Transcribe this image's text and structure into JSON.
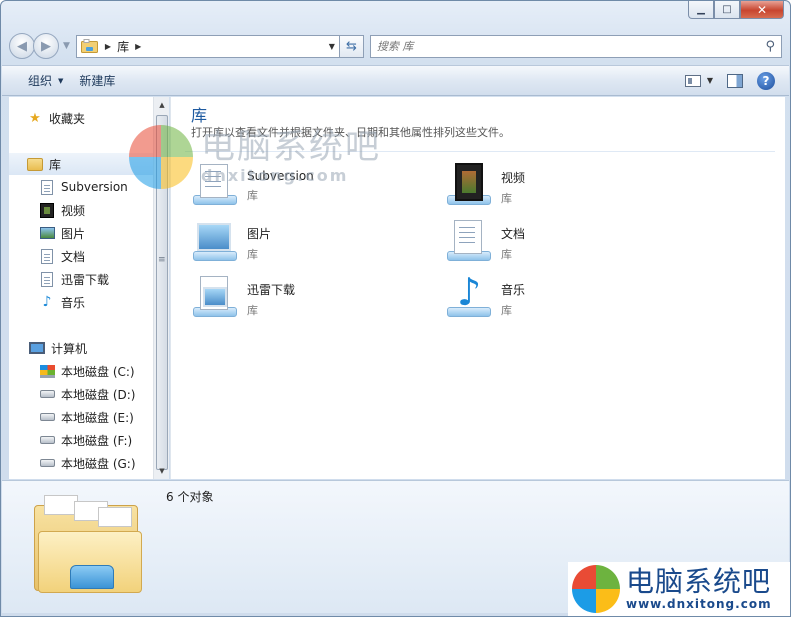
{
  "window": {
    "minimize_glyph": "▁",
    "maximize_glyph": "□",
    "close_glyph": "✕"
  },
  "address": {
    "crumb": "库",
    "search_placeholder": "搜索 库"
  },
  "toolbar": {
    "organize_label": "组织",
    "new_library_label": "新建库"
  },
  "sidebar": {
    "favorites": "收藏夹",
    "library": "库",
    "library_items": [
      "Subversion",
      "视频",
      "图片",
      "文档",
      "迅雷下载",
      "音乐"
    ],
    "computer": "计算机",
    "drives": [
      "本地磁盘 (C:)",
      "本地磁盘 (D:)",
      "本地磁盘 (E:)",
      "本地磁盘 (F:)",
      "本地磁盘 (G:)"
    ]
  },
  "content": {
    "title": "库",
    "subtitle": "打开库以查看文件并根据文件夹、日期和其他属性排列这些文件。",
    "tiles": [
      {
        "name": "Subversion",
        "kind": "库",
        "icon": "subversion-library-icon"
      },
      {
        "name": "视频",
        "kind": "库",
        "icon": "videos-library-icon"
      },
      {
        "name": "图片",
        "kind": "库",
        "icon": "pictures-library-icon"
      },
      {
        "name": "文档",
        "kind": "库",
        "icon": "documents-library-icon"
      },
      {
        "name": "迅雷下载",
        "kind": "库",
        "icon": "thunder-downloads-library-icon"
      },
      {
        "name": "音乐",
        "kind": "库",
        "icon": "music-library-icon"
      }
    ]
  },
  "details": {
    "count": "6 个对象"
  },
  "watermark": {
    "cn": "电脑系统吧",
    "url": "www.dnxitong.com",
    "url_top": "dnxitong.com"
  }
}
